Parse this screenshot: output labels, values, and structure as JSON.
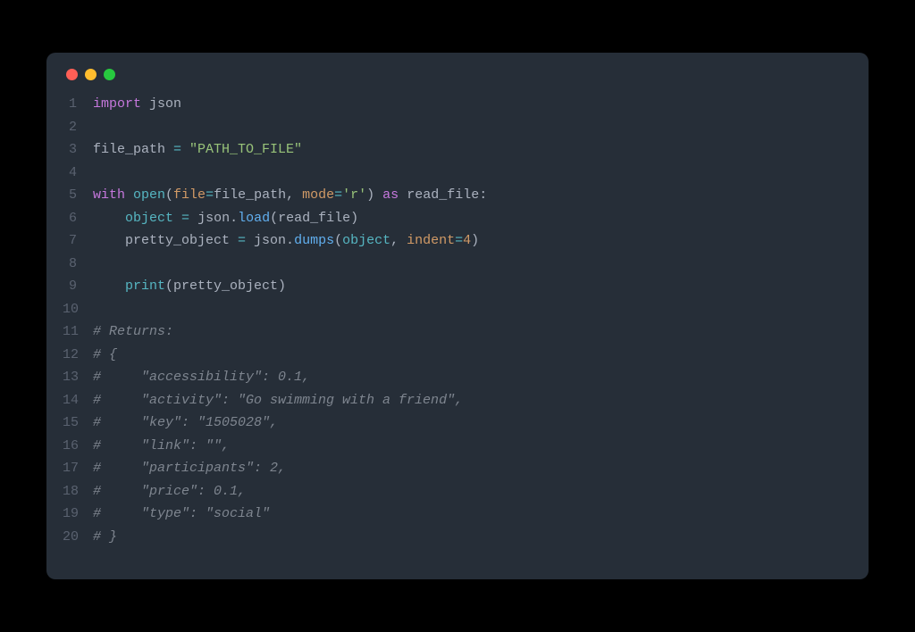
{
  "window": {
    "buttons": [
      "close",
      "minimize",
      "maximize"
    ]
  },
  "code": {
    "lines": [
      {
        "n": 1,
        "tokens": [
          [
            "kw",
            "import"
          ],
          [
            "",
            ""
          ],
          [
            "ident",
            " json"
          ]
        ]
      },
      {
        "n": 2,
        "tokens": []
      },
      {
        "n": 3,
        "tokens": [
          [
            "ident",
            "file_path "
          ],
          [
            "op",
            "="
          ],
          [
            "",
            ""
          ],
          [
            "str",
            " \"PATH_TO_FILE\""
          ]
        ]
      },
      {
        "n": 4,
        "tokens": []
      },
      {
        "n": 5,
        "tokens": [
          [
            "kw",
            "with"
          ],
          [
            "",
            ""
          ],
          [
            "builtin",
            " open"
          ],
          [
            "ident",
            "("
          ],
          [
            "param",
            "file"
          ],
          [
            "op",
            "="
          ],
          [
            "ident",
            "file_path, "
          ],
          [
            "param",
            "mode"
          ],
          [
            "op",
            "="
          ],
          [
            "str",
            "'r'"
          ],
          [
            "ident",
            ") "
          ],
          [
            "kw",
            "as"
          ],
          [
            "ident",
            " read_file:"
          ]
        ]
      },
      {
        "n": 6,
        "tokens": [
          [
            "ident",
            "    "
          ],
          [
            "builtin",
            "object"
          ],
          [
            "ident",
            " "
          ],
          [
            "op",
            "="
          ],
          [
            "ident",
            " json."
          ],
          [
            "fn",
            "load"
          ],
          [
            "ident",
            "(read_file)"
          ]
        ]
      },
      {
        "n": 7,
        "tokens": [
          [
            "ident",
            "    pretty_object "
          ],
          [
            "op",
            "="
          ],
          [
            "ident",
            " json."
          ],
          [
            "fn",
            "dumps"
          ],
          [
            "ident",
            "("
          ],
          [
            "builtin",
            "object"
          ],
          [
            "ident",
            ", "
          ],
          [
            "param",
            "indent"
          ],
          [
            "op",
            "="
          ],
          [
            "num",
            "4"
          ],
          [
            "ident",
            ")"
          ]
        ]
      },
      {
        "n": 8,
        "tokens": []
      },
      {
        "n": 9,
        "tokens": [
          [
            "ident",
            "    "
          ],
          [
            "builtin",
            "print"
          ],
          [
            "ident",
            "(pretty_object)"
          ]
        ]
      },
      {
        "n": 10,
        "tokens": []
      },
      {
        "n": 11,
        "tokens": [
          [
            "comment",
            "# Returns:"
          ]
        ]
      },
      {
        "n": 12,
        "tokens": [
          [
            "comment",
            "# {"
          ]
        ]
      },
      {
        "n": 13,
        "tokens": [
          [
            "comment",
            "#     \"accessibility\": 0.1,"
          ]
        ]
      },
      {
        "n": 14,
        "tokens": [
          [
            "comment",
            "#     \"activity\": \"Go swimming with a friend\","
          ]
        ]
      },
      {
        "n": 15,
        "tokens": [
          [
            "comment",
            "#     \"key\": \"1505028\","
          ]
        ]
      },
      {
        "n": 16,
        "tokens": [
          [
            "comment",
            "#     \"link\": \"\","
          ]
        ]
      },
      {
        "n": 17,
        "tokens": [
          [
            "comment",
            "#     \"participants\": 2,"
          ]
        ]
      },
      {
        "n": 18,
        "tokens": [
          [
            "comment",
            "#     \"price\": 0.1,"
          ]
        ]
      },
      {
        "n": 19,
        "tokens": [
          [
            "comment",
            "#     \"type\": \"social\""
          ]
        ]
      },
      {
        "n": 20,
        "tokens": [
          [
            "comment",
            "# }"
          ]
        ]
      }
    ]
  }
}
